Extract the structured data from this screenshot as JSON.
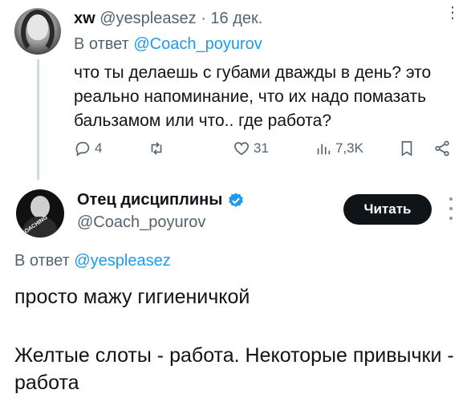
{
  "reply_tweet": {
    "display_name": "xw",
    "handle": "@yespleasez",
    "separator": "·",
    "date": "16 дек.",
    "replying_prefix": "В ответ",
    "replying_handle": "@Coach_poyurov",
    "text": "что ты делаешь с губами дважды в день? это реально напоминание, что их надо помазать бальзамом или что.. где работа?",
    "more_label": "⋮",
    "actions": {
      "replies": "4",
      "reposts": "",
      "likes": "31",
      "views": "7,3K"
    }
  },
  "main_tweet": {
    "display_name": "Отец дисциплины",
    "handle": "@Coach_poyurov",
    "follow_label": "Читать",
    "avatar_text": "COACHING",
    "replying_prefix": "В ответ",
    "replying_handle": "@yespleasez",
    "text_line1": "просто мажу гигиеничкой",
    "text_line2": "Желтые слоты - работа. Некоторые привычки - работа"
  },
  "colors": {
    "text": "#0f1419",
    "muted": "#536471",
    "link": "#1d9bf0",
    "verified": "#1d9bf0",
    "button_bg": "#0f1419",
    "thread_line": "#cfd9de"
  }
}
